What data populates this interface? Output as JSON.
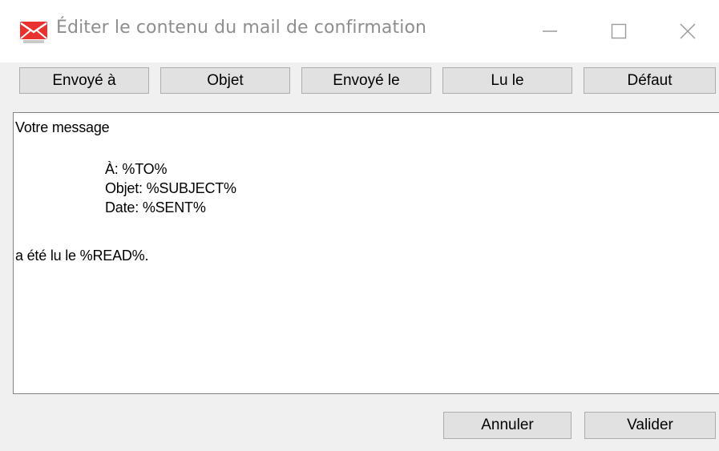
{
  "window": {
    "title": "Éditer le contenu du mail de confirmation",
    "app_icon": "envelope-icon",
    "controls": [
      "minimize-icon",
      "maximize-icon",
      "close-icon"
    ]
  },
  "toolbar": {
    "to_label": "Envoyé à",
    "subject_label": "Objet",
    "sent_label": "Envoyé le",
    "read_label": "Lu le",
    "default_label": "Défaut"
  },
  "editor": {
    "lines": [
      "Votre message",
      "À: %TO%",
      "Objet: %SUBJECT%",
      "Date: %SENT%",
      "a été lu le %READ%."
    ]
  },
  "footer": {
    "cancel_label": "Annuler",
    "validate_label": "Valider"
  },
  "colors": {
    "icon_red": "#e8322f",
    "title_gray": "#8e8e8e",
    "button_face": "#e1e1e1",
    "button_border": "#adadad"
  }
}
